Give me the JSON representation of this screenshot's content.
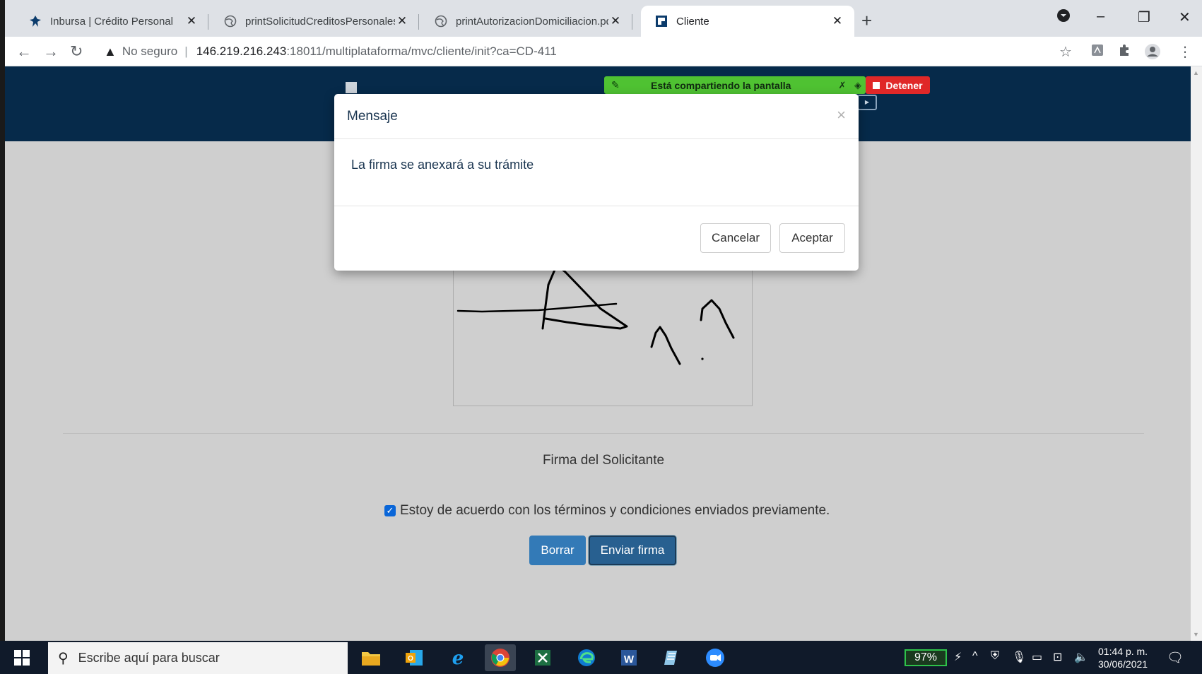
{
  "browser": {
    "tabs": [
      {
        "title": "Inbursa | Crédito Personal",
        "icon": "inbursa-favicon"
      },
      {
        "title": "printSolicitudCreditosPersonales.pdf",
        "icon": "globe-icon"
      },
      {
        "title": "printAutorizacionDomiciliacion.pdf",
        "icon": "globe-icon"
      },
      {
        "title": "Cliente",
        "icon": "inbursa-favicon"
      }
    ],
    "new_tab": "+",
    "window_controls": {
      "minimize": "–",
      "restore": "❐",
      "close": "✕"
    },
    "address": {
      "security_label": "No seguro",
      "host": "146.219.216.243",
      "path": ":18011/multiplataforma/mvc/cliente/init?ca=CD-411"
    }
  },
  "share_bar": {
    "text": "Está compartiendo la pantalla",
    "stop_label": "Detener"
  },
  "modal": {
    "title": "Mensaje",
    "close": "×",
    "message": "La firma se anexará a su trámite",
    "cancel_label": "Cancelar",
    "accept_label": "Aceptar"
  },
  "page": {
    "signature_label": "Firma del Solicitante",
    "terms_text": "Estoy de acuerdo con los términos y condiciones enviados previamente.",
    "terms_checked": true,
    "clear_label": "Borrar",
    "send_label": "Enviar firma"
  },
  "taskbar": {
    "search_placeholder": "Escribe aquí para buscar",
    "apps": [
      "file-explorer-icon",
      "outlook-icon",
      "internet-explorer-icon",
      "chrome-icon",
      "excel-icon",
      "edge-icon",
      "word-icon",
      "notepad-icon",
      "zoom-icon"
    ],
    "battery": "97%",
    "time": "01:44 p. m.",
    "date": "30/06/2021"
  },
  "colors": {
    "header_bg": "#062a4a",
    "primary_button": "#337ab7",
    "share_bar": "#4fc232",
    "stop_button": "#e02828"
  }
}
